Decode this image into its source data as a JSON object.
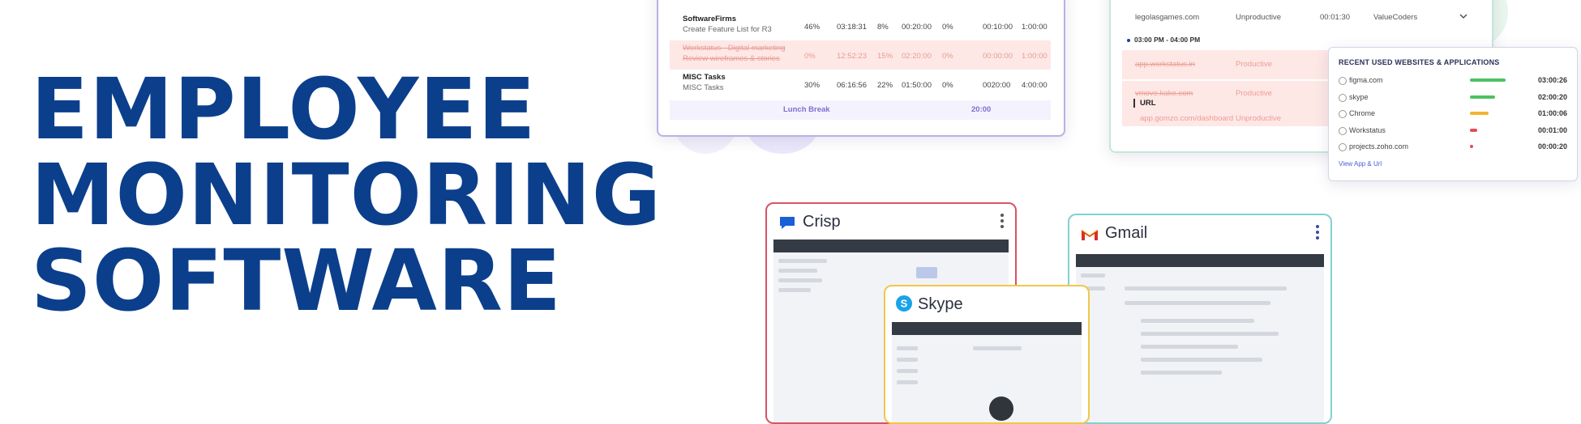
{
  "headline": [
    "EMPLOYEE",
    "MONITORING",
    "SOFTWARE"
  ],
  "time_table": {
    "rows": [
      {
        "name": "SoftwareFirms",
        "sub": "Create Feature List for R3",
        "c1": "46%",
        "c2": "03:18:31",
        "c3": "8%",
        "c4": "00:20:00",
        "c5": "0%",
        "c6": "00:10:00",
        "c7": "1:00:00",
        "style": "normal"
      },
      {
        "name": "Workstatus - Digital marketing",
        "sub": "Review wireframes & stories",
        "c1": "0%",
        "c2": "12:52:23",
        "c3": "15%",
        "c4": "02:20:00",
        "c5": "0%",
        "c6": "00:00:00",
        "c7": "1:00:00",
        "style": "red"
      },
      {
        "name": "MISC Tasks",
        "sub": "MISC Tasks",
        "c1": "30%",
        "c2": "06:16:56",
        "c3": "22%",
        "c4": "01:50:00",
        "c5": "0%",
        "c6": "0020:00",
        "c7": "4:00:00",
        "style": "normal"
      }
    ],
    "lunch_label": "Lunch Break",
    "lunch_time": "20:00"
  },
  "url_panel": {
    "row1": {
      "site": "legolasgames.com",
      "status": "Unproductive",
      "time": "00:01:30",
      "project": "ValueCoders"
    },
    "time_range": "03:00 PM - 04:00 PM",
    "row2": {
      "site": "app.workstatus.in",
      "status": "Productive"
    },
    "row3": {
      "site": "vmove.kako.com",
      "status": "Productive"
    },
    "url_label": "URL",
    "row4": {
      "site": "app.gomzo.com/dashboard",
      "status": "Unproductive"
    }
  },
  "recent": {
    "title": "RECENT USED WEBSITES & APPLICATIONS",
    "items": [
      {
        "name": "figma.com",
        "time": "03:00:26",
        "color": "#4cc264",
        "fill": 0.85
      },
      {
        "name": "skype",
        "time": "02:00:20",
        "color": "#4cc264",
        "fill": 0.6
      },
      {
        "name": "Chrome",
        "time": "01:00:06",
        "color": "#f1b42f",
        "fill": 0.45
      },
      {
        "name": "Workstatus",
        "time": "00:01:00",
        "color": "#e14d5b",
        "fill": 0.17
      },
      {
        "name": "projects.zoho.com",
        "time": "00:00:20",
        "color": "#e14d5b",
        "fill": 0.08
      }
    ],
    "link": "View App & Url"
  },
  "windows": {
    "crisp": "Crisp",
    "skype": "Skype",
    "gmail": "Gmail"
  },
  "colors": {
    "headline": "#0b3f8c",
    "crisp_border": "#d95363",
    "skype_border": "#efc84a",
    "gmail_border": "#83d0d1"
  }
}
